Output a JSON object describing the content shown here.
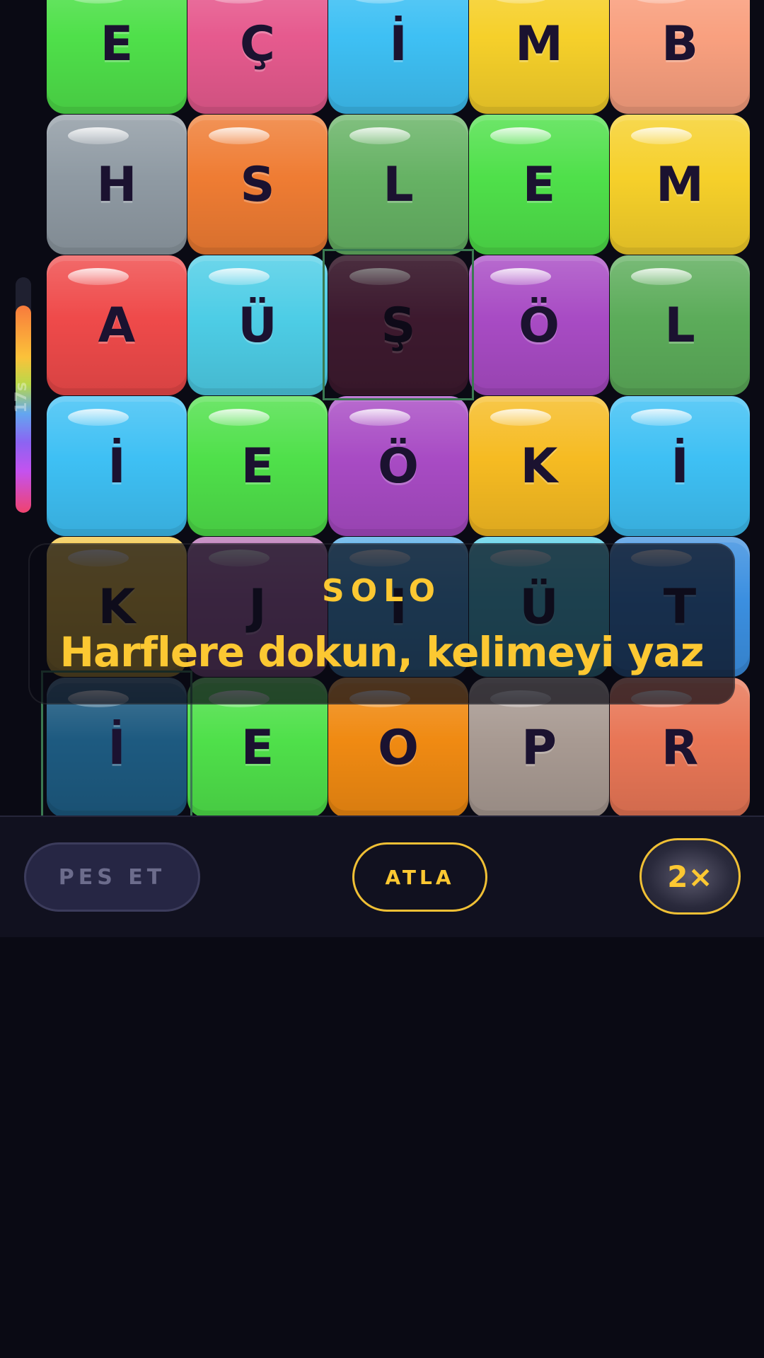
{
  "board": {
    "rows": [
      [
        {
          "letter": "E",
          "color": "#4fe04a"
        },
        {
          "letter": "Ç",
          "color": "#e65a8e"
        },
        {
          "letter": "İ",
          "color": "#3ec0f4"
        },
        {
          "letter": "M",
          "color": "#f6d02a"
        },
        {
          "letter": "B",
          "color": "#f9a07f"
        }
      ],
      [
        {
          "letter": "H",
          "color": "#8f9aa3"
        },
        {
          "letter": "S",
          "color": "#ef7c33"
        },
        {
          "letter": "L",
          "color": "#66b264"
        },
        {
          "letter": "E",
          "color": "#4fe04a"
        },
        {
          "letter": "M",
          "color": "#f6d02a"
        }
      ],
      [
        {
          "letter": "A",
          "color": "#ef4a4a"
        },
        {
          "letter": "Ü",
          "color": "#4dcde6"
        },
        {
          "letter": "Ş",
          "color": "#7a2a5a",
          "dim": true
        },
        {
          "letter": "Ö",
          "color": "#a84bc4"
        },
        {
          "letter": "L",
          "color": "#5cac5a"
        }
      ],
      [
        {
          "letter": "İ",
          "color": "#3ec0f4"
        },
        {
          "letter": "E",
          "color": "#4fe04a"
        },
        {
          "letter": "Ö",
          "color": "#a84bc4"
        },
        {
          "letter": "K",
          "color": "#f6bb22"
        },
        {
          "letter": "İ",
          "color": "#3ec0f4"
        }
      ],
      [
        {
          "letter": "K",
          "color": "#f2c33a"
        },
        {
          "letter": "J",
          "color": "#b46ab0"
        },
        {
          "letter": "I",
          "color": "#4aa8e6"
        },
        {
          "letter": "Ü",
          "color": "#4dcde6"
        },
        {
          "letter": "T",
          "color": "#3b8fe0"
        }
      ],
      [
        {
          "letter": "İ",
          "color": "#1d5a80",
          "dim": false
        },
        {
          "letter": "E",
          "color": "#4fe04a"
        },
        {
          "letter": "O",
          "color": "#f08a12"
        },
        {
          "letter": "P",
          "color": "#a89a92"
        },
        {
          "letter": "R",
          "color": "#e87656"
        }
      ]
    ]
  },
  "timer": {
    "label": "17s",
    "fraction": 0.88
  },
  "banner": {
    "mode": "SOLO",
    "hint": "Harflere dokun, kelimeyi yaz"
  },
  "actions": {
    "give_up": "PES ET",
    "skip": "ATLA",
    "multiplier": "2×"
  },
  "colors": {
    "accent": "#fcc832",
    "background": "#0a0a14"
  }
}
